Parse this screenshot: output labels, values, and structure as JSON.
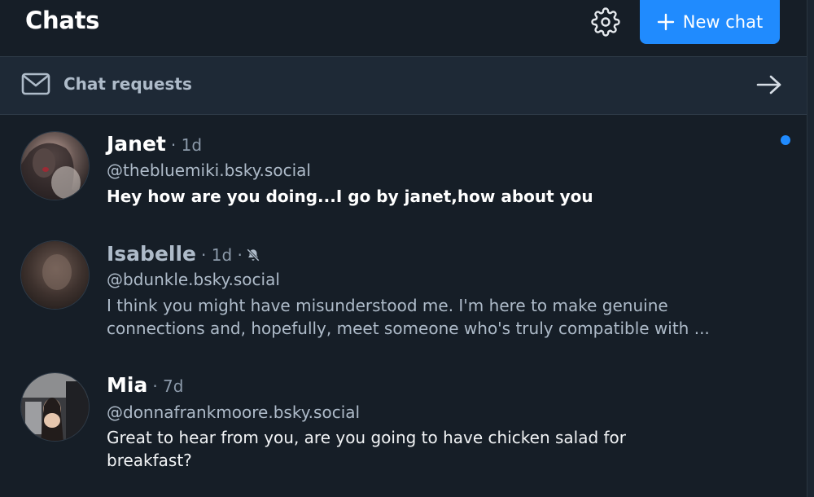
{
  "header": {
    "title": "Chats",
    "new_chat_label": "New chat"
  },
  "requests": {
    "label": "Chat requests"
  },
  "chats": [
    {
      "name": "Janet",
      "time": "· 1d",
      "handle": "@thebluemiki.bsky.social",
      "preview": "Hey how are you doing...I go by janet,how about you",
      "unread": true,
      "muted": false
    },
    {
      "name": "Isabelle",
      "time": "· 1d ·",
      "handle": "@bdunkle.bsky.social",
      "preview": "I think you might have misunderstood me. I'm here to make genuine connections and, hopefully, meet someone who's truly compatible with ...",
      "unread": false,
      "muted": true
    },
    {
      "name": "Mia",
      "time": "· 7d",
      "handle": "@donnafrankmoore.bsky.social",
      "preview": "Great to hear from you, are you going to have chicken salad for breakfast?",
      "unread": false,
      "muted": false
    }
  ],
  "colors": {
    "background": "#161e27",
    "accent": "#208bfe",
    "requests_row": "#1e2936"
  },
  "icons": {
    "settings": "gear-icon",
    "new_chat": "plus-icon",
    "requests": "envelope-icon",
    "requests_go": "arrow-right-icon",
    "muted": "bell-off-icon"
  }
}
